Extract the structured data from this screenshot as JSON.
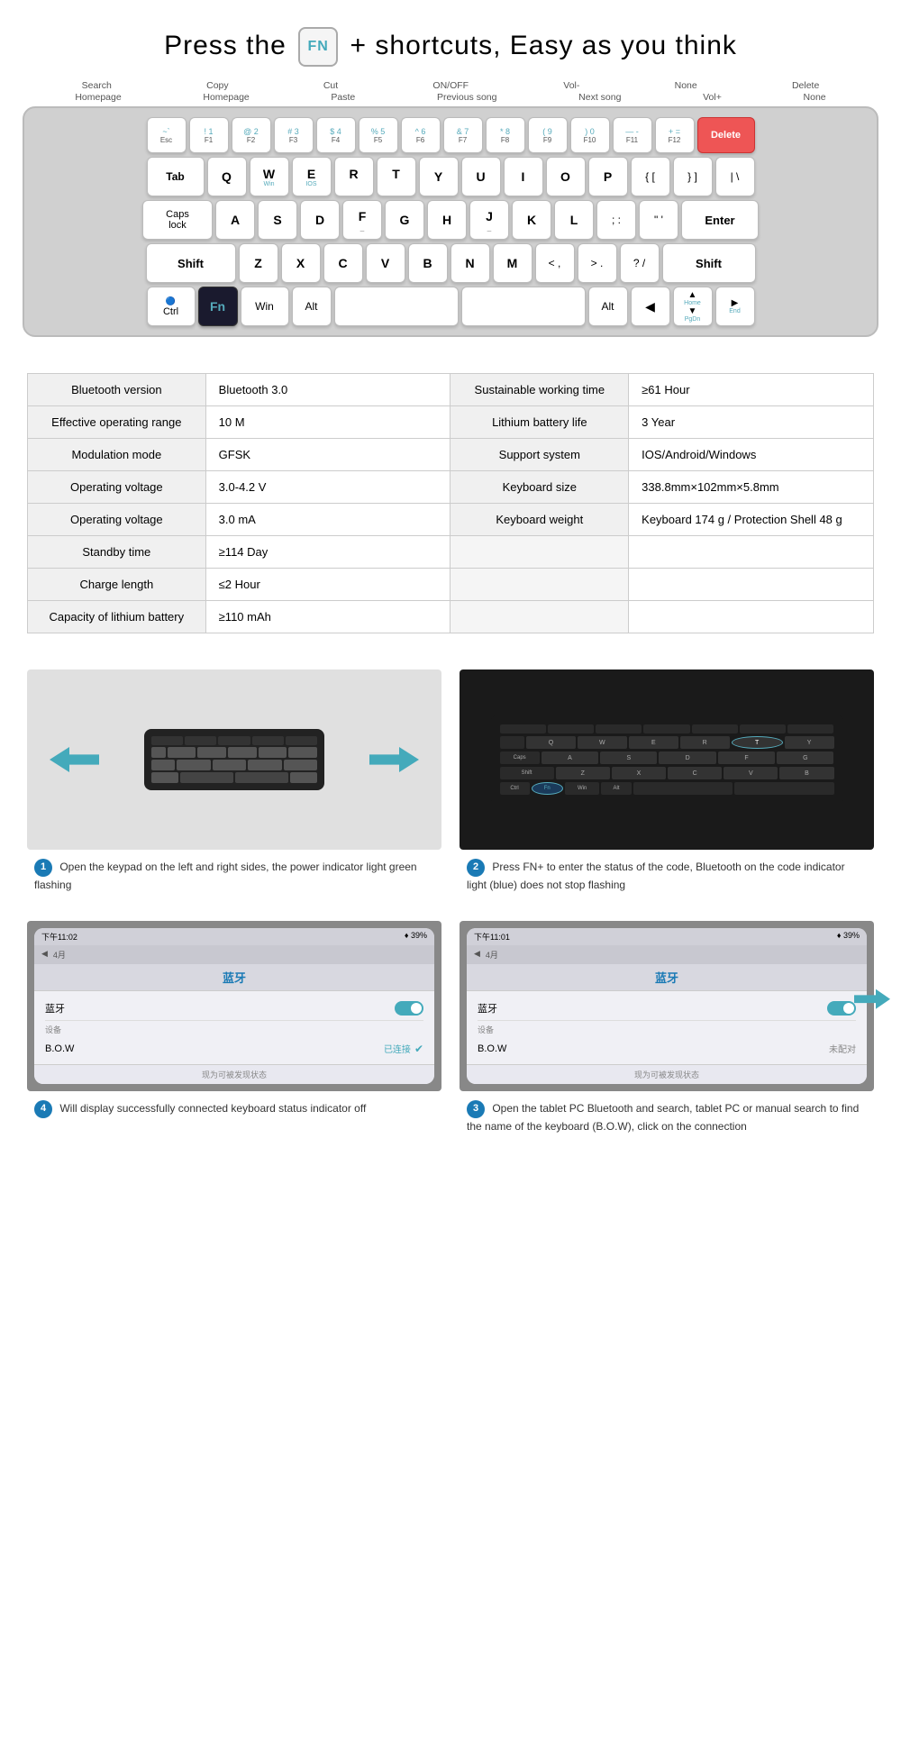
{
  "header": {
    "title_prefix": "Press the",
    "fn_label": "FN",
    "plus": "+",
    "title_suffix": "shortcuts, Easy as you think"
  },
  "shortcuts": {
    "top_row": [
      "Search",
      "Copy",
      "Cut",
      "ON/OFF",
      "Vol-",
      "None",
      "Delete"
    ],
    "bottom_row": [
      "Homepage",
      "Homepage",
      "Paste",
      "Previous song",
      "Next song",
      "Vol+",
      "None"
    ]
  },
  "keyboard": {
    "rows": [
      {
        "keys": [
          {
            "label": "~ `",
            "sub": "Esc",
            "width": "w1"
          },
          {
            "label": "! 1",
            "sub": "F1",
            "width": "w1"
          },
          {
            "label": "@ 2",
            "sub": "F2",
            "width": "w1"
          },
          {
            "label": "# 3",
            "sub": "F3",
            "width": "w1"
          },
          {
            "label": "$ 4",
            "sub": "F4",
            "width": "w1"
          },
          {
            "label": "% 5",
            "sub": "F5",
            "width": "w1"
          },
          {
            "label": "^ 6",
            "sub": "F6",
            "width": "w1"
          },
          {
            "label": "& 7",
            "sub": "F7",
            "width": "w1"
          },
          {
            "label": "* 8",
            "sub": "F8",
            "width": "w1"
          },
          {
            "label": "( 9",
            "sub": "F9",
            "width": "w1"
          },
          {
            "label": ") 0",
            "sub": "F10",
            "width": "w1"
          },
          {
            "label": "— -",
            "sub": "F11",
            "width": "w1"
          },
          {
            "label": "+ =",
            "sub": "F12",
            "width": "w1"
          },
          {
            "label": "Delete",
            "sub": "",
            "width": "w1h",
            "special": "delete"
          }
        ]
      },
      {
        "keys": [
          {
            "label": "Tab",
            "sub": "",
            "width": "w-tab"
          },
          {
            "label": "Q",
            "sub": "",
            "width": "w1"
          },
          {
            "label": "W",
            "sub": "Win",
            "width": "w1"
          },
          {
            "label": "E",
            "sub": "IOS",
            "width": "w1"
          },
          {
            "label": "R",
            "sub": "",
            "width": "w1"
          },
          {
            "label": "T",
            "sub": "",
            "width": "w1"
          },
          {
            "label": "Y",
            "sub": "",
            "width": "w1"
          },
          {
            "label": "U",
            "sub": "",
            "width": "w1"
          },
          {
            "label": "I",
            "sub": "",
            "width": "w1"
          },
          {
            "label": "O",
            "sub": "",
            "width": "w1"
          },
          {
            "label": "P",
            "sub": "",
            "width": "w1"
          },
          {
            "label": "{ [",
            "sub": "",
            "width": "w1"
          },
          {
            "label": "} ]",
            "sub": "",
            "width": "w1"
          },
          {
            "label": "| \\",
            "sub": "",
            "width": "w1"
          }
        ]
      },
      {
        "keys": [
          {
            "label": "Caps lock",
            "sub": "",
            "width": "w-caps"
          },
          {
            "label": "A",
            "sub": "",
            "width": "w1"
          },
          {
            "label": "S",
            "sub": "",
            "width": "w1"
          },
          {
            "label": "D",
            "sub": "",
            "width": "w1"
          },
          {
            "label": "F",
            "sub": "_",
            "width": "w1"
          },
          {
            "label": "G",
            "sub": "",
            "width": "w1"
          },
          {
            "label": "H",
            "sub": "",
            "width": "w1"
          },
          {
            "label": "J",
            "sub": "_",
            "width": "w1"
          },
          {
            "label": "K",
            "sub": "",
            "width": "w1"
          },
          {
            "label": "L",
            "sub": "",
            "width": "w1"
          },
          {
            "label": ": ;",
            "sub": "",
            "width": "w1"
          },
          {
            "label": "\" '",
            "sub": "",
            "width": "w1"
          },
          {
            "label": "Enter",
            "sub": "",
            "width": "w-enter"
          }
        ]
      },
      {
        "keys": [
          {
            "label": "Shift",
            "sub": "",
            "width": "w-shift-l"
          },
          {
            "label": "Z",
            "sub": "",
            "width": "w1"
          },
          {
            "label": "X",
            "sub": "",
            "width": "w1"
          },
          {
            "label": "C",
            "sub": "",
            "width": "w1"
          },
          {
            "label": "V",
            "sub": "",
            "width": "w1"
          },
          {
            "label": "B",
            "sub": "",
            "width": "w1"
          },
          {
            "label": "N",
            "sub": "",
            "width": "w1"
          },
          {
            "label": "M",
            "sub": "",
            "width": "w1"
          },
          {
            "label": "< ,",
            "sub": "",
            "width": "w1"
          },
          {
            "label": "> .",
            "sub": "",
            "width": "w1"
          },
          {
            "label": "? /",
            "sub": "",
            "width": "w1"
          },
          {
            "label": "Shift",
            "sub": "",
            "width": "w-shift-r"
          }
        ]
      },
      {
        "keys": [
          {
            "label": "Ctrl",
            "sub": "🔵",
            "width": "w-ctrl"
          },
          {
            "label": "Fn",
            "sub": "",
            "width": "w1",
            "fn": true
          },
          {
            "label": "Win",
            "sub": "",
            "width": "w-win"
          },
          {
            "label": "Alt",
            "sub": "",
            "width": "w-alt"
          },
          {
            "label": "",
            "sub": "",
            "width": "w-space1"
          },
          {
            "label": "",
            "sub": "",
            "width": "w-space2"
          },
          {
            "label": "Alt",
            "sub": "",
            "width": "w-alt"
          },
          {
            "label": "◀",
            "sub": "",
            "width": "w1"
          },
          {
            "label": "▲ Home / ▼ PgDn",
            "sub": "",
            "width": "w1"
          },
          {
            "label": "▶ End",
            "sub": "",
            "width": "w1"
          }
        ]
      }
    ]
  },
  "specs": {
    "rows": [
      {
        "col1_label": "Bluetooth version",
        "col1_value": "Bluetooth  3.0",
        "col2_label": "Sustainable working time",
        "col2_value": "≥61  Hour"
      },
      {
        "col1_label": "Effective operating range",
        "col1_value": "10  M",
        "col2_label": "Lithium battery life",
        "col2_value": "3  Year"
      },
      {
        "col1_label": "Modulation mode",
        "col1_value": "GFSK",
        "col2_label": "Support system",
        "col2_value": "IOS/Android/Windows"
      },
      {
        "col1_label": "Operating voltage",
        "col1_value": "3.0-4.2  V",
        "col2_label": "Keyboard size",
        "col2_value": "338.8mm×102mm×5.8mm"
      },
      {
        "col1_label": "Operating voltage",
        "col1_value": "3.0  mA",
        "col2_label": "Keyboard weight",
        "col2_value": "Keyboard  174  g  /  Protection Shell  48  g"
      },
      {
        "col1_label": "Standby time",
        "col1_value": "≥114  Day",
        "col2_label": "",
        "col2_value": ""
      },
      {
        "col1_label": "Charge length",
        "col1_value": "≤2  Hour",
        "col2_label": "",
        "col2_value": ""
      },
      {
        "col1_label": "Capacity of lithium battery",
        "col1_value": "≥110  mAh",
        "col2_label": "",
        "col2_value": ""
      }
    ]
  },
  "instructions": {
    "step1": {
      "badge": "1",
      "text": "Open the keypad on the left and right sides, the power indicator light green flashing"
    },
    "step2": {
      "badge": "2",
      "text": "Press FN+ to enter the status of the code, Bluetooth on the code indicator light (blue) does not stop flashing"
    },
    "step3": {
      "badge": "3",
      "text": "Open the tablet PC Bluetooth and search, tablet PC or manual search to find the name of the keyboard (B.O.W), click on the connection"
    },
    "step4": {
      "badge": "4",
      "text": "Will display successfully connected keyboard status indicator off"
    },
    "bluetooth": {
      "title": "蓝牙",
      "time_connected": "下午11:02",
      "time_searching": "下午11:01",
      "battery_connected": "♦ 39%",
      "battery_searching": "♦ 39%",
      "bluetooth_label": "蓝牙",
      "devices_label": "设备",
      "bow_label": "B.O.W",
      "connected_label": "已连接",
      "not_paired_label": "未配对",
      "footer": "现为可被发现状态"
    }
  }
}
